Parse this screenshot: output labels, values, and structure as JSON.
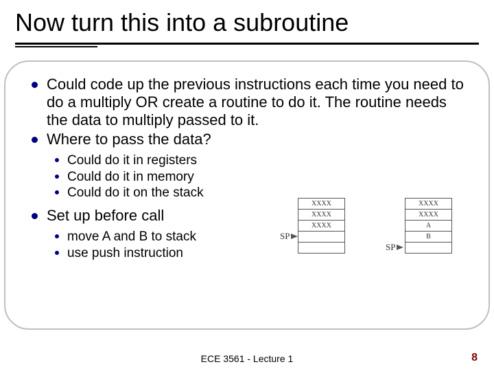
{
  "title": "Now turn this into a subroutine",
  "bullets": {
    "a": "Could code up the previous instructions each time you need to do a multiply OR create a routine to do it.  The routine needs the data to multiply passed to it.",
    "b": "Where to pass the data?",
    "b_sub": {
      "a": "Could do it in registers",
      "b": "Could do it in memory",
      "c": "Could do it on the stack"
    },
    "c": "Set up before call",
    "c_sub": {
      "a": "move A and B to stack",
      "b": "use push instruction"
    }
  },
  "diagram": {
    "sp_label": "SP",
    "left": {
      "r0": "XXXX",
      "r1": "XXXX",
      "r2": "XXXX"
    },
    "right": {
      "r0": "XXXX",
      "r1": "XXXX",
      "r2": "A",
      "r3": "B"
    }
  },
  "footer": {
    "center": "ECE 3561 - Lecture 1",
    "pagenum": "8"
  }
}
